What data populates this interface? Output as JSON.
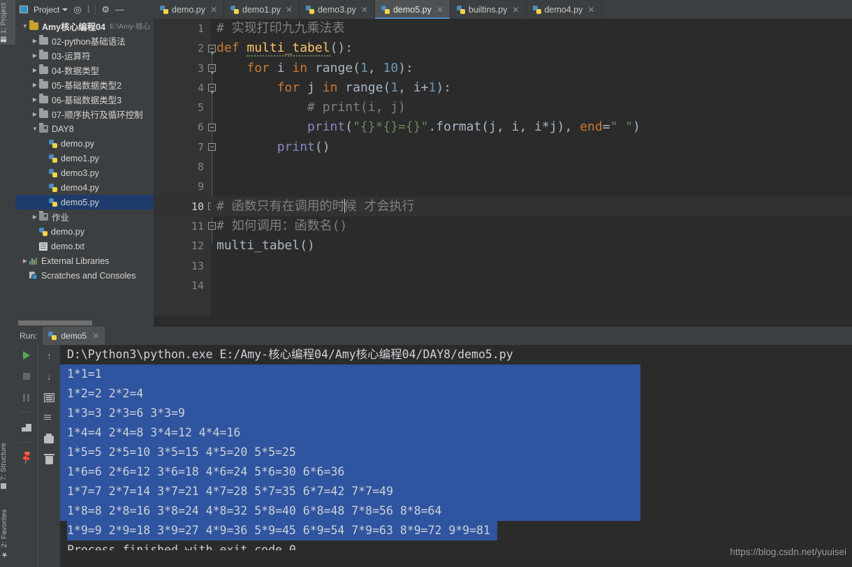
{
  "rail": {
    "top_label": "1: Project",
    "structure_label": "7: Structure",
    "favorites_label": "2: Favorites"
  },
  "toolbar": {
    "project_label": "Project",
    "locate_icon": "crosshair-icon",
    "collapse_icon": "collapse-all-icon",
    "settings_icon": "gear-icon",
    "hide_icon": "minimize-icon"
  },
  "tabs": [
    {
      "label": "demo.py",
      "active": false
    },
    {
      "label": "demo1.py",
      "active": false
    },
    {
      "label": "demo3.py",
      "active": false
    },
    {
      "label": "demo5.py",
      "active": true
    },
    {
      "label": "builtins.py",
      "active": false
    },
    {
      "label": "demo4.py",
      "active": false
    }
  ],
  "tree": [
    {
      "label": "Amy核心编程04",
      "path": "E:\\Amy-核心",
      "depth": 0,
      "arrow": "▼",
      "kind": "folder-src",
      "bold": true,
      "selected": false
    },
    {
      "label": "02-python基础语法",
      "path": "",
      "depth": 1,
      "arrow": "▶",
      "kind": "folder",
      "bold": false,
      "selected": false
    },
    {
      "label": "03-运算符",
      "path": "",
      "depth": 1,
      "arrow": "▶",
      "kind": "folder",
      "bold": false,
      "selected": false
    },
    {
      "label": "04-数据类型",
      "path": "",
      "depth": 1,
      "arrow": "▶",
      "kind": "folder",
      "bold": false,
      "selected": false
    },
    {
      "label": "05-基础数据类型2",
      "path": "",
      "depth": 1,
      "arrow": "▶",
      "kind": "folder",
      "bold": false,
      "selected": false
    },
    {
      "label": "06-基础数据类型3",
      "path": "",
      "depth": 1,
      "arrow": "▶",
      "kind": "folder",
      "bold": false,
      "selected": false
    },
    {
      "label": "07-顺序执行及循环控制",
      "path": "",
      "depth": 1,
      "arrow": "▶",
      "kind": "folder",
      "bold": false,
      "selected": false
    },
    {
      "label": "DAY8",
      "path": "",
      "depth": 1,
      "arrow": "▼",
      "kind": "folder-dark",
      "bold": false,
      "selected": false
    },
    {
      "label": "demo.py",
      "path": "",
      "depth": 2,
      "arrow": "",
      "kind": "py",
      "bold": false,
      "selected": false
    },
    {
      "label": "demo1.py",
      "path": "",
      "depth": 2,
      "arrow": "",
      "kind": "py",
      "bold": false,
      "selected": false
    },
    {
      "label": "demo3.py",
      "path": "",
      "depth": 2,
      "arrow": "",
      "kind": "py",
      "bold": false,
      "selected": false
    },
    {
      "label": "demo4.py",
      "path": "",
      "depth": 2,
      "arrow": "",
      "kind": "py",
      "bold": false,
      "selected": false
    },
    {
      "label": "demo5.py",
      "path": "",
      "depth": 2,
      "arrow": "",
      "kind": "py",
      "bold": false,
      "selected": true
    },
    {
      "label": "作业",
      "path": "",
      "depth": 1,
      "arrow": "▶",
      "kind": "folder-dark",
      "bold": false,
      "selected": false
    },
    {
      "label": "demo.py",
      "path": "",
      "depth": 1,
      "arrow": "",
      "kind": "py",
      "bold": false,
      "selected": false
    },
    {
      "label": "demo.txt",
      "path": "",
      "depth": 1,
      "arrow": "",
      "kind": "txt",
      "bold": false,
      "selected": false
    },
    {
      "label": "External Libraries",
      "path": "",
      "depth": 0,
      "arrow": "▶",
      "kind": "lib",
      "bold": false,
      "selected": false
    },
    {
      "label": "Scratches and Consoles",
      "path": "",
      "depth": 0,
      "arrow": "",
      "kind": "scratch",
      "bold": false,
      "selected": false
    }
  ],
  "editor": {
    "line_numbers": [
      "1",
      "2",
      "3",
      "4",
      "5",
      "6",
      "7",
      "8",
      "9",
      "10",
      "11",
      "12",
      "13",
      "14"
    ],
    "current_line": 10,
    "lines": [
      "# 实现打印九九乘法表",
      "def multi_tabel():",
      "    for i in range(1, 10):",
      "        for j in range(1, i+1):",
      "            # print(i, j)",
      "            print(\"{}*{}={}\".format(j, i, i*j), end=\" \")",
      "        print()",
      "",
      "",
      "# 函数只有在调用的时候 才会执行",
      "# 如何调用：函数名()",
      "multi_tabel()",
      "",
      ""
    ]
  },
  "run_panel": {
    "run_label": "Run:",
    "tab_label": "demo5",
    "tools": [
      "run-icon",
      "stop-icon",
      "pause-icon",
      "restore-layout-icon",
      "pin-icon",
      "scroll-up-icon",
      "scroll-down-icon",
      "soft-wrap-icon",
      "scroll-to-end-icon",
      "print-icon",
      "clear-all-icon"
    ],
    "command": "D:\\Python3\\python.exe E:/Amy-核心编程04/Amy核心编程04/DAY8/demo5.py",
    "output": [
      "1*1=1 ",
      "1*2=2 2*2=4 ",
      "1*3=3 2*3=6 3*3=9 ",
      "1*4=4 2*4=8 3*4=12 4*4=16 ",
      "1*5=5 2*5=10 3*5=15 4*5=20 5*5=25 ",
      "1*6=6 2*6=12 3*6=18 4*6=24 5*6=30 6*6=36 ",
      "1*7=7 2*7=14 3*7=21 4*7=28 5*7=35 6*7=42 7*7=49 ",
      "1*8=8 2*8=16 3*8=24 4*8=32 5*8=40 6*8=48 7*8=56 8*8=64 ",
      "1*9=9 2*9=18 3*9=27 4*9=36 5*9=45 6*9=54 7*9=63 8*9=72 9*9=81 "
    ],
    "exit_line": "Process finished with exit code 0"
  },
  "watermark": "https://blog.csdn.net/yuuisei",
  "colors": {
    "accent": "#4a88c7",
    "selection": "#2f54a0",
    "tree_selection": "#1f3b6b",
    "keyword": "#cc7832",
    "function": "#ffc66d",
    "number": "#6897bb",
    "string": "#6a8759",
    "comment": "#808080",
    "editor_bg": "#2b2b2b",
    "panel_bg": "#3c3f41"
  }
}
